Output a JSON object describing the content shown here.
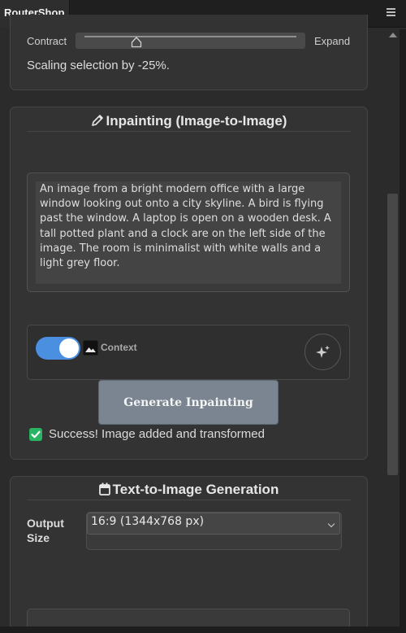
{
  "window": {
    "title": "RouterShop",
    "menu_icon": "hamburger-icon"
  },
  "scale_panel": {
    "left_label": "Contract",
    "right_label": "Expand",
    "slider_value_percent": -25,
    "status": "Scaling selection by -25%."
  },
  "inpainting": {
    "title_icon": "pencil-icon",
    "title": "Inpainting (Image-to-Image)",
    "prompt": "An image from a bright modern office with a large window looking out onto a city skyline. A bird is flying past the window. A laptop is open on a wooden desk. A tall potted plant and a clock are on the left side of the image. The room is minimalist with white walls and a light grey floor.",
    "context_toggle_on": true,
    "context_label": "Context",
    "enhance_icon": "sparkle-icon",
    "generate_label": "Generate Inpainting",
    "success_message": "Success! Image added and transformed"
  },
  "text_to_image": {
    "title_icon": "calendar-icon",
    "title": "Text-to-Image Generation",
    "output_size_label": "Output Size",
    "output_size_value": "16:9 (1344x768 px)"
  },
  "colors": {
    "accent_toggle": "#4a8fe0",
    "success": "#28b463",
    "button": "#7a8591"
  }
}
